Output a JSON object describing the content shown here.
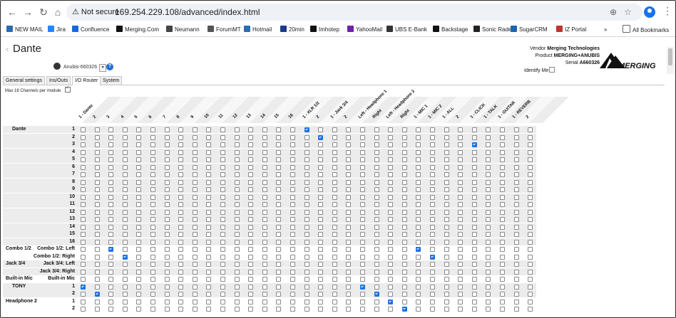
{
  "browser": {
    "security_label": "Not secure",
    "url": "169.254.229.108/advanced/index.html",
    "all_bookmarks": "All Bookmarks",
    "bookmarks": [
      {
        "label": "NEW MAIL",
        "color": "#2b6cb0"
      },
      {
        "label": "Jira",
        "color": "#2684ff"
      },
      {
        "label": "Confluence",
        "color": "#1868db"
      },
      {
        "label": "Merging.Com",
        "color": "#111111"
      },
      {
        "label": "Neumann",
        "color": "#444444"
      },
      {
        "label": "ForumMT",
        "color": "#555555"
      },
      {
        "label": "Hotmail",
        "color": "#2b6cb0"
      },
      {
        "label": "20min",
        "color": "#1d3a8a"
      },
      {
        "label": "Imhotep",
        "color": "#111111"
      },
      {
        "label": "YahooMail",
        "color": "#6b21a8"
      },
      {
        "label": "UBS E-Bank",
        "color": "#333333"
      },
      {
        "label": "Backstage",
        "color": "#111111"
      },
      {
        "label": "Sonic Rade",
        "color": "#222222"
      },
      {
        "label": "SugarCRM",
        "color": "#1d64b0"
      },
      {
        "label": "IZ Portal",
        "color": "#c53030"
      }
    ]
  },
  "app": {
    "logo": "Dante",
    "device": "Anubis-660326",
    "vendor_label": "Vendor",
    "vendor": "Merging Technologies",
    "product_label": "Product",
    "product": "MERGING+ANUBIS",
    "serial_label": "Serial",
    "serial": "A660326",
    "identify_label": "Identify Me",
    "brand": "MERGING",
    "tabs": [
      "General settings",
      "Ins/Outs",
      "I/O Router",
      "System"
    ],
    "active_tab": 2,
    "max_channels_label": "Max 16 Channels per module",
    "max_channels_checked": true
  },
  "router": {
    "columns": [
      "1 - Dante",
      "2",
      "3",
      "4",
      "5",
      "6",
      "7",
      "8",
      "9",
      "10",
      "11",
      "12",
      "13",
      "14",
      "15",
      "16",
      "1 - XLR 1/2",
      "2",
      "1 - Jack 3/4",
      "2",
      "Left - Headphone 1",
      "Right",
      "Left - Headphone 2",
      "Right",
      "1 - MIC 1",
      "1 - MIC 2",
      "1 - ALL",
      "2",
      "1 - CLICK",
      "1 - TALK",
      "1 - GUITAR",
      "1 - REVERB",
      "2"
    ],
    "rows": [
      {
        "group": "Dante",
        "label": "1",
        "shade": true,
        "on": [
          16
        ]
      },
      {
        "group": "",
        "label": "2",
        "shade": true,
        "on": [
          17
        ]
      },
      {
        "group": "",
        "label": "3",
        "shade": true,
        "on": [
          28
        ]
      },
      {
        "group": "",
        "label": "4",
        "shade": true,
        "on": []
      },
      {
        "group": "",
        "label": "5",
        "shade": true,
        "on": []
      },
      {
        "group": "",
        "label": "6",
        "shade": true,
        "on": []
      },
      {
        "group": "",
        "label": "7",
        "shade": true,
        "on": []
      },
      {
        "group": "",
        "label": "8",
        "shade": true,
        "on": []
      },
      {
        "group": "",
        "label": "9",
        "shade": true,
        "on": []
      },
      {
        "group": "",
        "label": "10",
        "shade": true,
        "on": []
      },
      {
        "group": "",
        "label": "11",
        "shade": true,
        "on": []
      },
      {
        "group": "",
        "label": "12",
        "shade": true,
        "on": []
      },
      {
        "group": "",
        "label": "13",
        "shade": true,
        "on": []
      },
      {
        "group": "",
        "label": "14",
        "shade": true,
        "on": []
      },
      {
        "group": "",
        "label": "15",
        "shade": true,
        "on": []
      },
      {
        "group": "",
        "label": "16",
        "shade": true,
        "on": []
      },
      {
        "group": "Combo 1/2",
        "label": "Combo 1/2: Left",
        "shade": false,
        "on": [
          2,
          24
        ]
      },
      {
        "group": "",
        "label": "Combo 1/2: Right",
        "shade": false,
        "on": [
          3,
          25
        ]
      },
      {
        "group": "Jack 3/4",
        "label": "Jack 3/4: Left",
        "shade": true,
        "on": []
      },
      {
        "group": "",
        "label": "Jack 3/4: Right",
        "shade": true,
        "on": []
      },
      {
        "group": "Built-in Mic",
        "label": "Built-in Mic",
        "shade": false,
        "on": []
      },
      {
        "group": "TONY",
        "label": "1",
        "shade": true,
        "on": [
          0,
          20
        ]
      },
      {
        "group": "",
        "label": "2",
        "shade": true,
        "on": [
          1,
          21
        ]
      },
      {
        "group": "Headphone 2",
        "label": "1",
        "shade": false,
        "on": [
          22
        ]
      },
      {
        "group": "",
        "label": "2",
        "shade": false,
        "on": [
          23
        ]
      }
    ]
  }
}
